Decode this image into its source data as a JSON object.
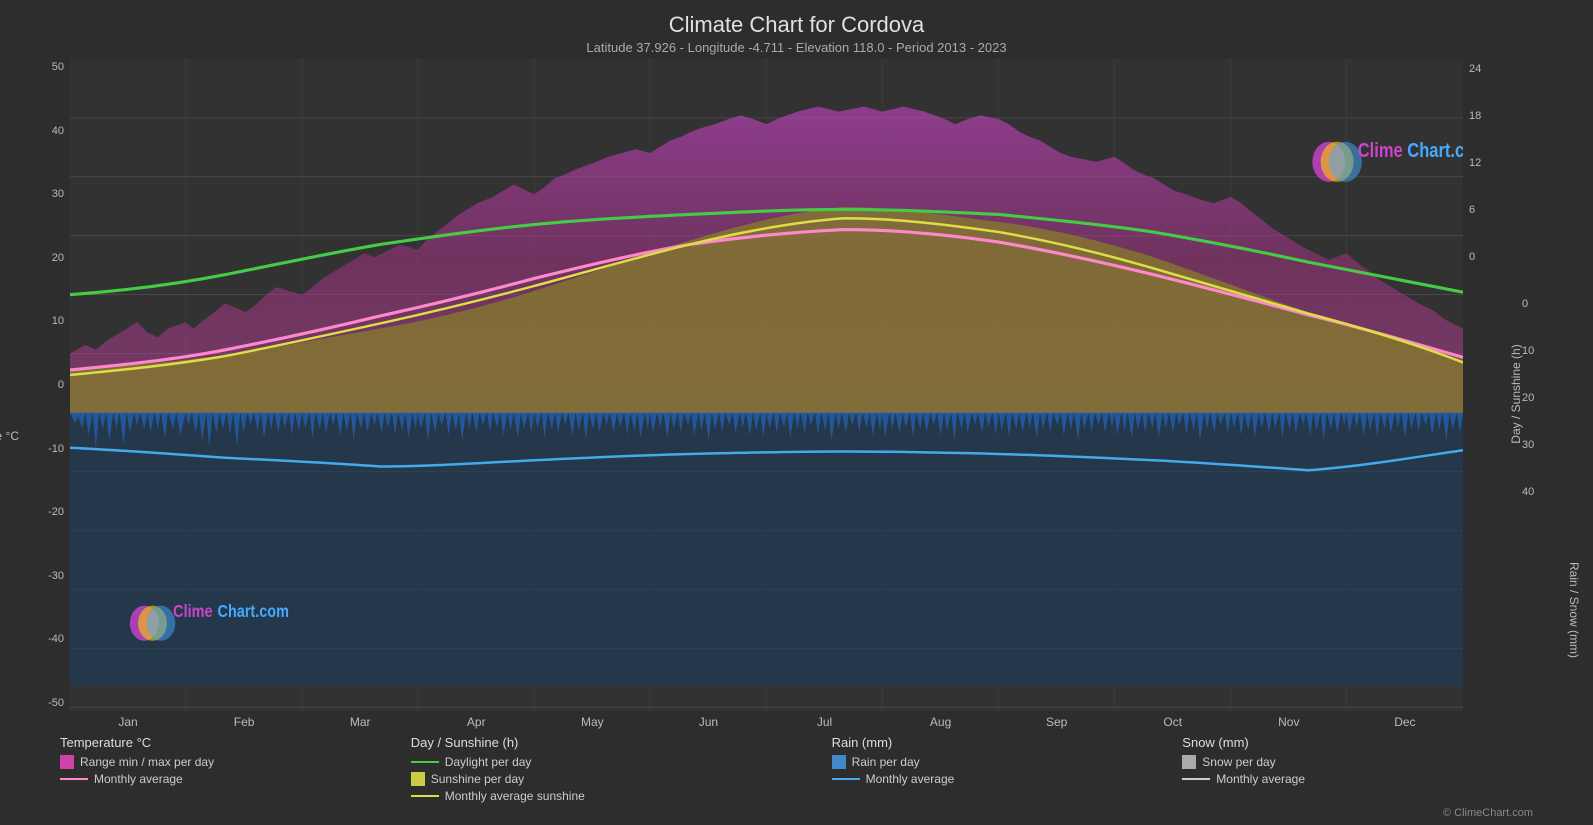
{
  "title": "Climate Chart for Cordova",
  "subtitle": "Latitude 37.926 - Longitude -4.711 - Elevation 118.0 - Period 2013 - 2023",
  "brand": {
    "text_clime": "Clime",
    "text_chart": "Chart",
    "text_com": ".com",
    "copyright": "© ClimeChart.com"
  },
  "y_axis_left": {
    "label": "Temperature °C",
    "values": [
      "50",
      "40",
      "30",
      "20",
      "10",
      "0",
      "-10",
      "-20",
      "-30",
      "-40",
      "-50"
    ]
  },
  "y_axis_right_sunshine": {
    "label": "Day / Sunshine (h)",
    "values": [
      "24",
      "18",
      "12",
      "6",
      "0"
    ]
  },
  "y_axis_right_rain": {
    "label": "Rain / Snow (mm)",
    "values": [
      "0",
      "10",
      "20",
      "30",
      "40"
    ]
  },
  "x_axis": {
    "months": [
      "Jan",
      "Feb",
      "Mar",
      "Apr",
      "May",
      "Jun",
      "Jul",
      "Aug",
      "Sep",
      "Oct",
      "Nov",
      "Dec"
    ]
  },
  "legend": {
    "col1": {
      "title": "Temperature °C",
      "items": [
        {
          "label": "Range min / max per day",
          "type": "rect",
          "color": "#cc44aa"
        },
        {
          "label": "Monthly average",
          "type": "line",
          "color": "#ff88cc"
        }
      ]
    },
    "col2": {
      "title": "Day / Sunshine (h)",
      "items": [
        {
          "label": "Daylight per day",
          "type": "line",
          "color": "#44cc44"
        },
        {
          "label": "Sunshine per day",
          "type": "rect",
          "color": "#cccc44"
        },
        {
          "label": "Monthly average sunshine",
          "type": "line",
          "color": "#dddd44"
        }
      ]
    },
    "col3": {
      "title": "Rain (mm)",
      "items": [
        {
          "label": "Rain per day",
          "type": "rect",
          "color": "#4488cc"
        },
        {
          "label": "Monthly average",
          "type": "line",
          "color": "#44aaee"
        }
      ]
    },
    "col4": {
      "title": "Snow (mm)",
      "items": [
        {
          "label": "Snow per day",
          "type": "rect",
          "color": "#aaaaaa"
        },
        {
          "label": "Monthly average",
          "type": "line",
          "color": "#cccccc"
        }
      ]
    }
  }
}
